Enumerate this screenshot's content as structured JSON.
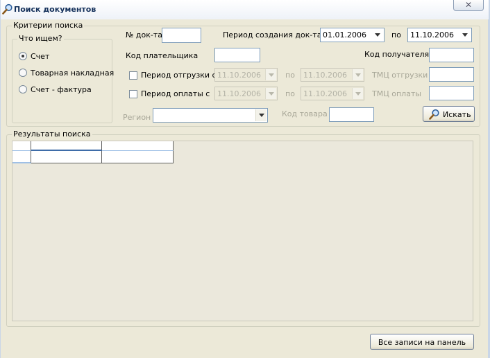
{
  "window": {
    "title": "Поиск документов",
    "close_glyph": "✕",
    "title_icon": "search-icon"
  },
  "criteria": {
    "legend": "Критерии поиска",
    "what_group": {
      "legend": "Что ищем?",
      "options": [
        {
          "label": "Счет",
          "selected": true
        },
        {
          "label": "Товарная накладная",
          "selected": false
        },
        {
          "label": "Счет - фактура",
          "selected": false
        }
      ]
    },
    "doc_number_label": "№ док-та",
    "doc_number_value": "",
    "creation_period_label": "Период создания док-та с",
    "creation_from": "01.01.2006",
    "creation_to_label": "по",
    "creation_to": "11.10.2006",
    "payer_code_label": "Код плательщика",
    "payer_code_value": "",
    "recipient_code_label": "Код получателя",
    "recipient_code_value": "",
    "shipment_label": "Период отгрузки с",
    "shipment_checked": false,
    "shipment_from": "11.10.2006",
    "shipment_to_label": "по",
    "shipment_to": "11.10.2006",
    "tmc_shipment_label": "ТМЦ отгрузки",
    "payment_label": "Период оплаты с",
    "payment_checked": false,
    "payment_from": "11.10.2006",
    "payment_to_label": "по",
    "payment_to": "11.10.2006",
    "tmc_payment_label": "ТМЦ оплаты",
    "region_label": "Регион",
    "region_value": "",
    "product_code_label": "Код товара",
    "product_code_value": "",
    "search_button": "Искать"
  },
  "results": {
    "legend": "Результаты поиска"
  },
  "footer": {
    "all_to_panel_button": "Все записи на панель"
  }
}
